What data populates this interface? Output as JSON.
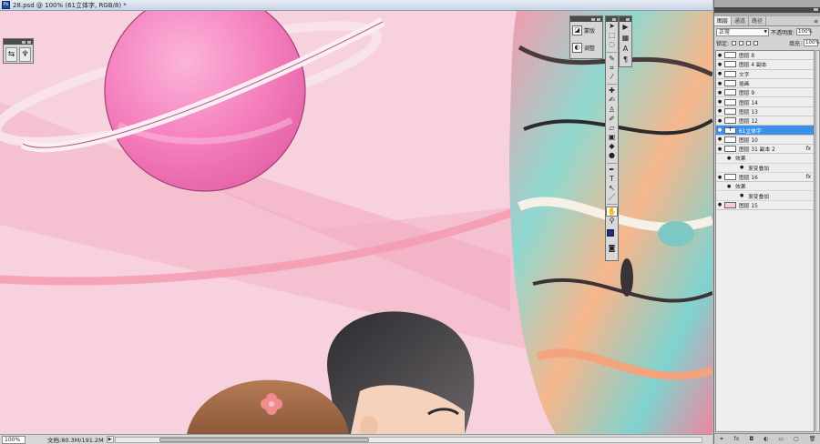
{
  "document": {
    "title": "28.psd @ 100% (61立体字, RGB/8) *",
    "app_icon": "Ps"
  },
  "status": {
    "zoom": "100%",
    "doc_size": "文档:80.3M/191.2M"
  },
  "adjust_panel": {
    "items": [
      {
        "icon": "mask-icon",
        "glyph": "◪",
        "label": "蒙版"
      },
      {
        "icon": "adjustment-icon",
        "glyph": "◐",
        "label": "调整"
      }
    ]
  },
  "nav_mini": {
    "buttons": [
      {
        "icon": "scale-icon",
        "glyph": "⇆"
      },
      {
        "icon": "bug-icon",
        "glyph": "♆"
      }
    ]
  },
  "toolbox": {
    "tools": [
      {
        "name": "move-tool-icon",
        "glyph": "➤"
      },
      {
        "name": "marquee-tool-icon",
        "glyph": "⬚"
      },
      {
        "name": "lasso-tool-icon",
        "glyph": "◌"
      },
      {
        "name": "quick-select-tool-icon",
        "glyph": "✎"
      },
      {
        "name": "crop-tool-icon",
        "glyph": "⌗"
      },
      {
        "name": "eyedropper-tool-icon",
        "glyph": "⁄"
      },
      {
        "name": "healing-tool-icon",
        "glyph": "✚"
      },
      {
        "name": "brush-tool-icon",
        "glyph": "✍"
      },
      {
        "name": "stamp-tool-icon",
        "glyph": "♙"
      },
      {
        "name": "history-brush-icon",
        "glyph": "✐"
      },
      {
        "name": "eraser-tool-icon",
        "glyph": "▱"
      },
      {
        "name": "gradient-tool-icon",
        "glyph": "▣"
      },
      {
        "name": "blur-tool-icon",
        "glyph": "◆"
      },
      {
        "name": "dodge-tool-icon",
        "glyph": "●"
      },
      {
        "name": "pen-tool-icon",
        "glyph": "✒"
      },
      {
        "name": "type-tool-icon",
        "glyph": "T"
      },
      {
        "name": "path-select-tool-icon",
        "glyph": "↖"
      },
      {
        "name": "shape-tool-icon",
        "glyph": "／"
      },
      {
        "name": "hand-tool-icon",
        "glyph": "✋"
      },
      {
        "name": "zoom-tool-icon",
        "glyph": "⚲"
      }
    ],
    "active_tool_index": 18
  },
  "tool_strip": {
    "tools": [
      {
        "name": "history-panel-icon",
        "glyph": "▶"
      },
      {
        "name": "swatches-panel-icon",
        "glyph": "▦"
      },
      {
        "name": "character-panel-icon",
        "glyph": "A"
      },
      {
        "name": "paragraph-panel-icon",
        "glyph": "¶"
      }
    ]
  },
  "layers_panel": {
    "tabs": [
      "图层",
      "通道",
      "路径"
    ],
    "active_tab": 0,
    "blend_mode": "正常",
    "opacity_label": "不透明度:",
    "opacity_value": "100%",
    "lock_label": "锁定:",
    "fill_label": "填充:",
    "fill_value": "100%",
    "footer_icons": [
      "link-icon",
      "fx-icon",
      "mask-icon",
      "adjustment-icon",
      "folder-icon",
      "new-layer-icon",
      "trash-icon"
    ],
    "footer_glyphs": [
      "⚭",
      "fx",
      "◘",
      "◐",
      "▭",
      "▢",
      "🗑"
    ],
    "rows": [
      {
        "type": "layer",
        "name": "图层 8",
        "thumb": "plain",
        "visible": true
      },
      {
        "type": "layer",
        "name": "图层 4 副本",
        "thumb": "plain",
        "visible": true
      },
      {
        "type": "layer",
        "name": "文字",
        "thumb": "plain",
        "visible": true
      },
      {
        "type": "layer",
        "name": "插画",
        "thumb": "plain",
        "visible": true
      },
      {
        "type": "layer",
        "name": "图层 9",
        "thumb": "plain",
        "visible": true
      },
      {
        "type": "layer",
        "name": "图层 14",
        "thumb": "plain",
        "visible": true
      },
      {
        "type": "layer",
        "name": "图层 13",
        "thumb": "plain",
        "visible": true
      },
      {
        "type": "layer",
        "name": "图层 12",
        "thumb": "plain",
        "visible": true
      },
      {
        "type": "layer",
        "name": "61立体字",
        "thumb": "text",
        "visible": true,
        "selected": true
      },
      {
        "type": "layer",
        "name": "图层 10",
        "thumb": "plain",
        "visible": true
      },
      {
        "type": "layer",
        "name": "图层 31 副本 2",
        "thumb": "plain",
        "visible": true,
        "fx": true
      },
      {
        "type": "effects",
        "name": "效果"
      },
      {
        "type": "effect",
        "name": "渐变叠加"
      },
      {
        "type": "layer",
        "name": "图层 16",
        "thumb": "plain",
        "visible": true,
        "fx": true
      },
      {
        "type": "effects",
        "name": "效果"
      },
      {
        "type": "effect",
        "name": "渐变叠加"
      },
      {
        "type": "layer",
        "name": "图层 15",
        "thumb": "pink",
        "visible": true
      }
    ]
  },
  "colors": {
    "canvas_bg": "#f8d1de",
    "selected_row": "#3e8fe8",
    "foreground": "#1a2b8f",
    "background": "#000000"
  }
}
